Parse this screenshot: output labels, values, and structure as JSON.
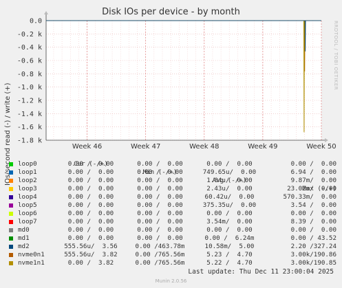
{
  "chart_data": {
    "type": "line",
    "title": "Disk IOs per device - by month",
    "ylabel": "IOs/second read (-) / write (+)",
    "ylim": [
      -1800,
      0
    ],
    "yticks": [
      {
        "value": 0,
        "label": "0.0"
      },
      {
        "value": -200,
        "label": "-0.2 k"
      },
      {
        "value": -400,
        "label": "-0.4 k"
      },
      {
        "value": -600,
        "label": "-0.6 k"
      },
      {
        "value": -800,
        "label": "-0.8 k"
      },
      {
        "value": -1000,
        "label": "-1.0 k"
      },
      {
        "value": -1200,
        "label": "-1.2 k"
      },
      {
        "value": -1400,
        "label": "-1.4 k"
      },
      {
        "value": -1600,
        "label": "-1.6 k"
      },
      {
        "value": -1800,
        "label": "-1.8 k"
      }
    ],
    "xlim": [
      45.3,
      50.0
    ],
    "xticks": [
      {
        "value": 46,
        "label": "Week 46"
      },
      {
        "value": 47,
        "label": "Week 47"
      },
      {
        "value": 48,
        "label": "Week 48"
      },
      {
        "value": 49,
        "label": "Week 49"
      },
      {
        "value": 50,
        "label": "Week 50"
      }
    ],
    "grid": true,
    "series": [
      {
        "name": "nvme0n1",
        "color": "#b25c0e",
        "points": [
          [
            45.3,
            0
          ],
          [
            49.71,
            0
          ],
          [
            49.715,
            -765.56
          ],
          [
            49.72,
            0
          ],
          [
            50.0,
            0
          ]
        ]
      },
      {
        "name": "nvme1n1",
        "color": "#b09000",
        "points": [
          [
            45.3,
            0
          ],
          [
            49.7,
            0
          ],
          [
            49.705,
            -1680
          ],
          [
            49.71,
            0
          ],
          [
            50.0,
            0
          ]
        ]
      },
      {
        "name": "md2",
        "color": "#1c4f6c",
        "points": [
          [
            45.3,
            0
          ],
          [
            49.72,
            0
          ],
          [
            49.725,
            -463.78
          ],
          [
            49.73,
            0
          ],
          [
            50.0,
            0
          ]
        ]
      }
    ]
  },
  "rrdtool_label": "RRDTOOL / TOBI OETIKER",
  "legend": {
    "headers": {
      "cur": "Cur (-/+)",
      "min": "Min (-/+)",
      "avg": "Avg (-/+)",
      "max": "Max (-/+)"
    },
    "rows": [
      {
        "name": "loop0",
        "color": "#00cc00",
        "cur": "0.00 /  0.00",
        "min": "0.00 /  0.00",
        "avg": "0.00 /  0.00",
        "max": "0.00 /  0.00"
      },
      {
        "name": "loop1",
        "color": "#0066b3",
        "cur": "0.00 /  0.00",
        "min": "0.00 /  0.00",
        "avg": "749.65u/  0.00",
        "max": "6.94 /  0.00"
      },
      {
        "name": "loop2",
        "color": "#ff8000",
        "cur": "0.00 /  0.00",
        "min": "0.00 /  0.00",
        "avg": "1.04u/  0.00",
        "max": "9.87m/  0.00"
      },
      {
        "name": "loop3",
        "color": "#ffcc00",
        "cur": "0.00 /  0.00",
        "min": "0.00 /  0.00",
        "avg": "2.43u/  0.00",
        "max": "23.02m/  0.00"
      },
      {
        "name": "loop4",
        "color": "#330099",
        "cur": "0.00 /  0.00",
        "min": "0.00 /  0.00",
        "avg": "60.42u/  0.00",
        "max": "570.33m/  0.00"
      },
      {
        "name": "loop5",
        "color": "#990099",
        "cur": "0.00 /  0.00",
        "min": "0.00 /  0.00",
        "avg": "375.35u/  0.00",
        "max": "3.54 /  0.00"
      },
      {
        "name": "loop6",
        "color": "#ccff00",
        "cur": "0.00 /  0.00",
        "min": "0.00 /  0.00",
        "avg": "0.00 /  0.00",
        "max": "0.00 /  0.00"
      },
      {
        "name": "loop7",
        "color": "#ff0000",
        "cur": "0.00 /  0.00",
        "min": "0.00 /  0.00",
        "avg": "3.54m/  0.00",
        "max": "8.39 /  0.00"
      },
      {
        "name": "md0",
        "color": "#808080",
        "cur": "0.00 /  0.00",
        "min": "0.00 /  0.00",
        "avg": "0.00 /  0.00",
        "max": "0.00 /  0.00"
      },
      {
        "name": "md1",
        "color": "#008f00",
        "cur": "0.00 /  0.00",
        "min": "0.00 /  0.00",
        "avg": "0.00 /  6.24m",
        "max": "0.00 / 43.52"
      },
      {
        "name": "md2",
        "color": "#00487d",
        "cur": "555.56u/  3.56",
        "min": "0.00 /463.78m",
        "avg": "10.58m/  5.00",
        "max": "2.20 /327.24"
      },
      {
        "name": "nvme0n1",
        "color": "#b35a00",
        "cur": "555.56u/  3.82",
        "min": "0.00 /765.56m",
        "avg": "5.23 /  4.70",
        "max": "3.00k/190.86"
      },
      {
        "name": "nvme1n1",
        "color": "#b38f00",
        "cur": "0.00 /  3.82",
        "min": "0.00 /765.56m",
        "avg": "5.22 /  4.70",
        "max": "3.00k/190.85"
      }
    ]
  },
  "last_update": "Last update: Thu Dec 11 23:00:04 2025",
  "munin_version": "Munin 2.0.56"
}
